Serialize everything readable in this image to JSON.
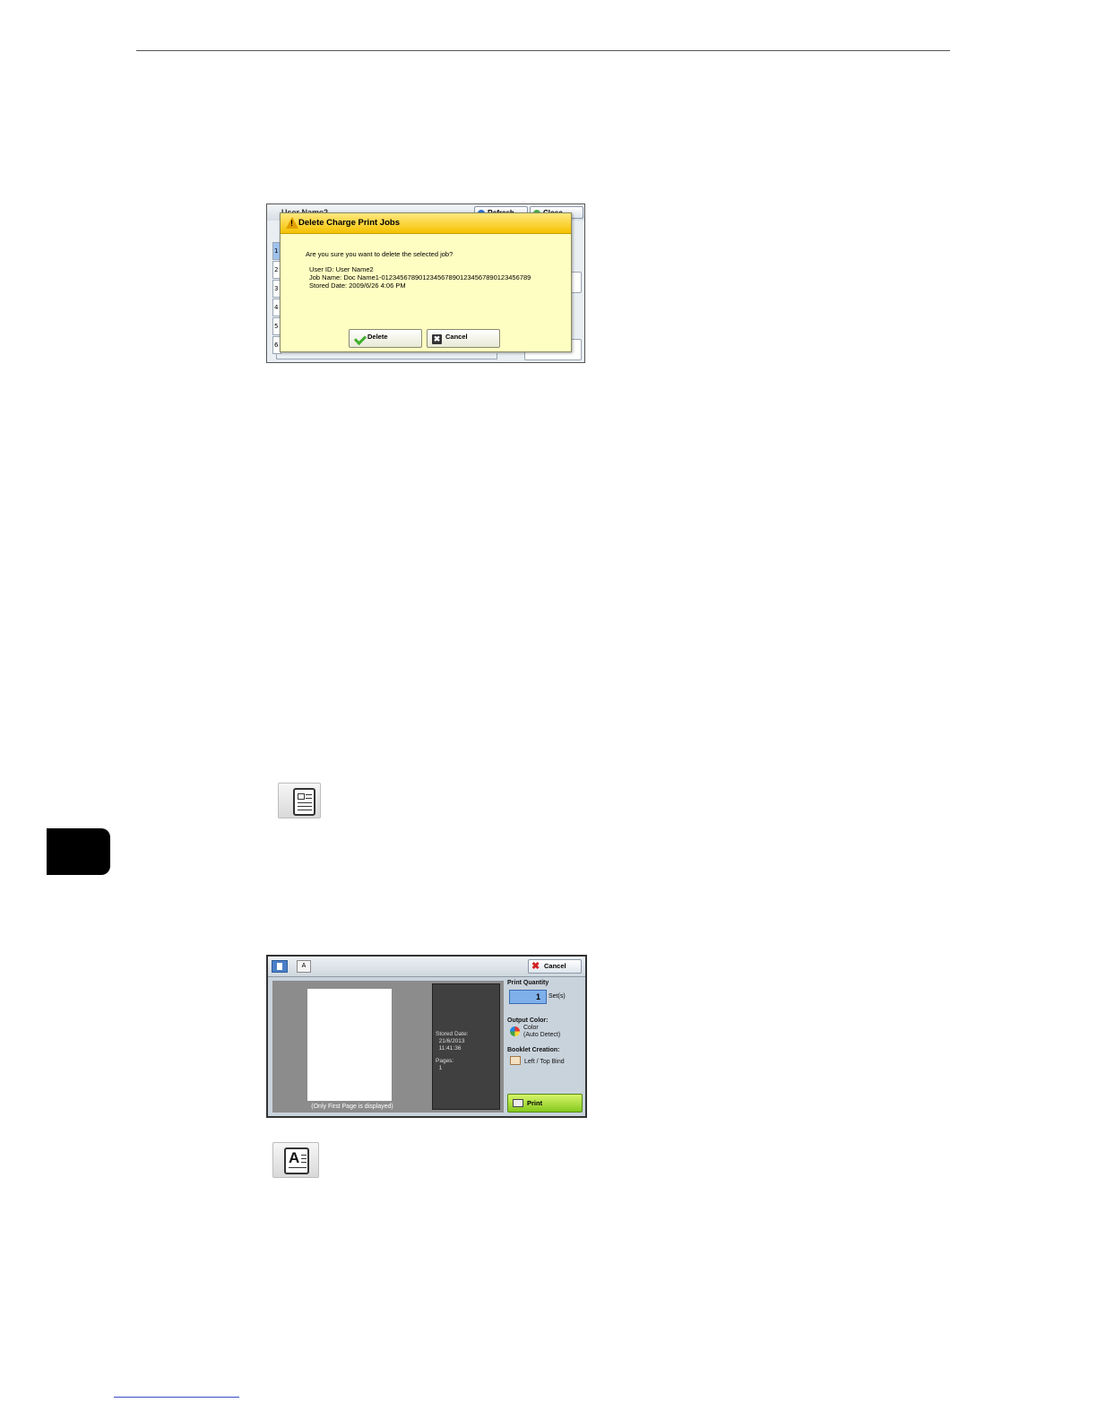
{
  "delete_dialog_screen": {
    "background": {
      "title": "User Name2",
      "refresh_label": "Refresh",
      "close_label": "Close",
      "rows": [
        "1",
        "2",
        "3",
        "4",
        "5",
        "6"
      ]
    },
    "dialog": {
      "title": "Delete Charge Print Jobs",
      "warning_glyph": "!",
      "question": "Are you sure you want to delete the selected job?",
      "user_id": "User ID: User Name2",
      "job_name": "Job Name: Doc Name1-0123456789012345678901234567890123456789",
      "stored_date": "Stored Date: 2009/6/26 4:06 PM",
      "delete_label": "Delete",
      "cancel_label": "Cancel",
      "cancel_glyph": "✖"
    }
  },
  "preview_screen": {
    "tab2_glyph": "A",
    "cancel_label": "Cancel",
    "cancel_glyph": "✖",
    "only_first_page": "(Only First Page is displayed)",
    "stored_date_info": "Stored Date:\n  21/6/2013\n  11:41:36",
    "pages_info": "Pages:\n  1",
    "print_quantity_label": "Print Quantity",
    "quantity_value": "1",
    "sets_label": "Set(s)",
    "output_color_label": "Output Color:",
    "output_color_value": "Color\n(Auto Detect)",
    "booklet_label": "Booklet Creation:",
    "booklet_value": "Left / Top Bind",
    "print_label": "Print"
  },
  "icons": {
    "icon_a_glyph": "A"
  },
  "colors": {
    "dialog_bg": "#fffec2",
    "dialog_header": "#f5c200",
    "print_button": "#86c81e"
  }
}
